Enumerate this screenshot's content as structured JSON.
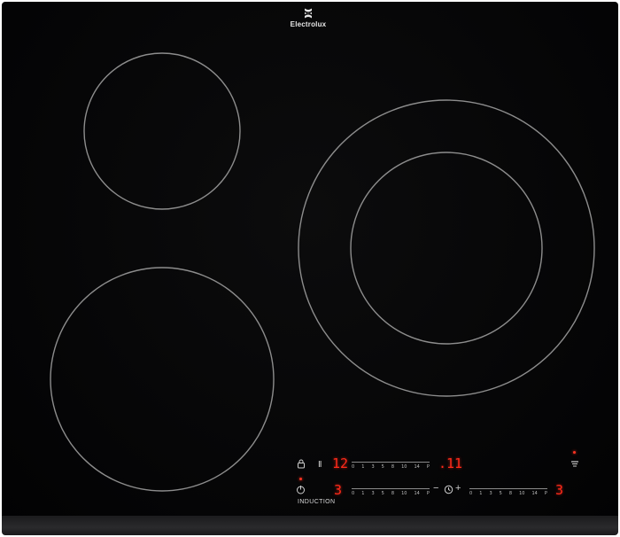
{
  "brand": {
    "name": "Electrolux"
  },
  "controls": {
    "induction_label": "INDUCTION",
    "pause_symbol": "II",
    "row1": {
      "power_display": "12",
      "timer_display": ".11",
      "scale_ticks": [
        "0",
        "1",
        "3",
        "5",
        "8",
        "10",
        "14",
        "P"
      ]
    },
    "row2": {
      "left_display": "3",
      "right_display": "3",
      "left_scale_ticks": [
        "0",
        "1",
        "3",
        "5",
        "8",
        "10",
        "14",
        "P"
      ],
      "right_scale_ticks": [
        "0",
        "1",
        "3",
        "5",
        "8",
        "10",
        "14",
        "P"
      ],
      "minus_symbol": "−",
      "plus_symbol": "+"
    }
  },
  "colors": {
    "indicator": "#ff2a1a",
    "surface": "#050506",
    "ring": "#8d8d8d"
  }
}
